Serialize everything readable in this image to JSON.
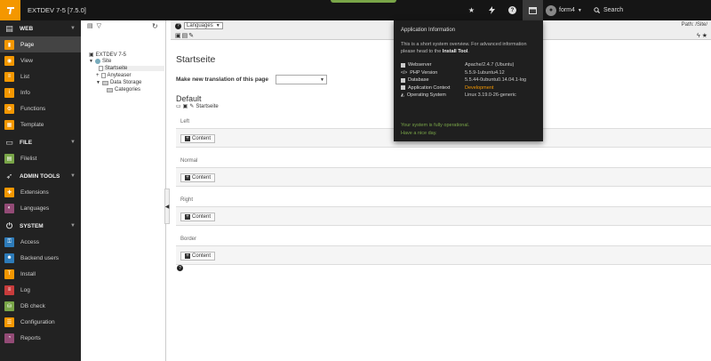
{
  "topbar": {
    "site_title": "EXTDEV 7-5 [7.5.0]",
    "user_name": "form4",
    "search_label": "Search",
    "icons": [
      "bookmark-star-icon",
      "flash-icon",
      "help-icon",
      "system-information-icon"
    ]
  },
  "modules": {
    "groups": [
      {
        "label": "WEB",
        "icon": "web-icon",
        "items": [
          {
            "label": "Page",
            "color": "#f49700",
            "active": true
          },
          {
            "label": "View",
            "color": "#f49700"
          },
          {
            "label": "List",
            "color": "#f49700"
          },
          {
            "label": "Info",
            "color": "#f49700"
          },
          {
            "label": "Functions",
            "color": "#f49700"
          },
          {
            "label": "Template",
            "color": "#f49700"
          }
        ]
      },
      {
        "label": "FILE",
        "icon": "file-icon",
        "items": [
          {
            "label": "Filelist",
            "color": "#79a548"
          }
        ]
      },
      {
        "label": "ADMIN TOOLS",
        "icon": "rocket-icon",
        "items": [
          {
            "label": "Extensions",
            "color": "#f49700"
          },
          {
            "label": "Languages",
            "color": "#934b76"
          }
        ]
      },
      {
        "label": "SYSTEM",
        "icon": "power-icon",
        "items": [
          {
            "label": "Access",
            "color": "#2d7bb9"
          },
          {
            "label": "Backend users",
            "color": "#2d7bb9"
          },
          {
            "label": "Install",
            "color": "#f49700"
          },
          {
            "label": "Log",
            "color": "#c83c3c"
          },
          {
            "label": "DB check",
            "color": "#79a548"
          },
          {
            "label": "Configuration",
            "color": "#f49700"
          },
          {
            "label": "Reports",
            "color": "#934b76"
          }
        ]
      }
    ]
  },
  "tree": {
    "root": "EXTDEV 7-5",
    "site": "Site",
    "pages": [
      "Startseite",
      "Anyteaser",
      "Data Storage",
      "Categories"
    ]
  },
  "docheader": {
    "language_select": "Languages",
    "path": "Path: /Site/"
  },
  "main": {
    "title": "Startseite",
    "translation_label": "Make new translation of this page",
    "language_heading": "Default",
    "language_page": "Startseite",
    "columns": [
      "Left",
      "Normal",
      "Right",
      "Border"
    ],
    "content_button": "Content"
  },
  "popover": {
    "title": "Application Information",
    "intro_before": "This is a short system overview. For advanced information please head to the",
    "intro_link": "Install Tool",
    "rows": [
      {
        "key": "Webserver",
        "value": "Apache/2.4.7 (Ubuntu)"
      },
      {
        "key": "PHP Version",
        "value": "5.5.9-1ubuntu4.12"
      },
      {
        "key": "Database",
        "value": "5.5.44-0ubuntu0.14.04.1-log"
      },
      {
        "key": "Application Context",
        "value": "Development"
      },
      {
        "key": "Operating System",
        "value": "Linux 3.19.0-26-generic"
      }
    ],
    "status_line1": "Your system is fully operational.",
    "status_line2": "Have a nice day."
  },
  "colors": {
    "brand_orange": "#f49700",
    "success_green": "#79a548"
  }
}
